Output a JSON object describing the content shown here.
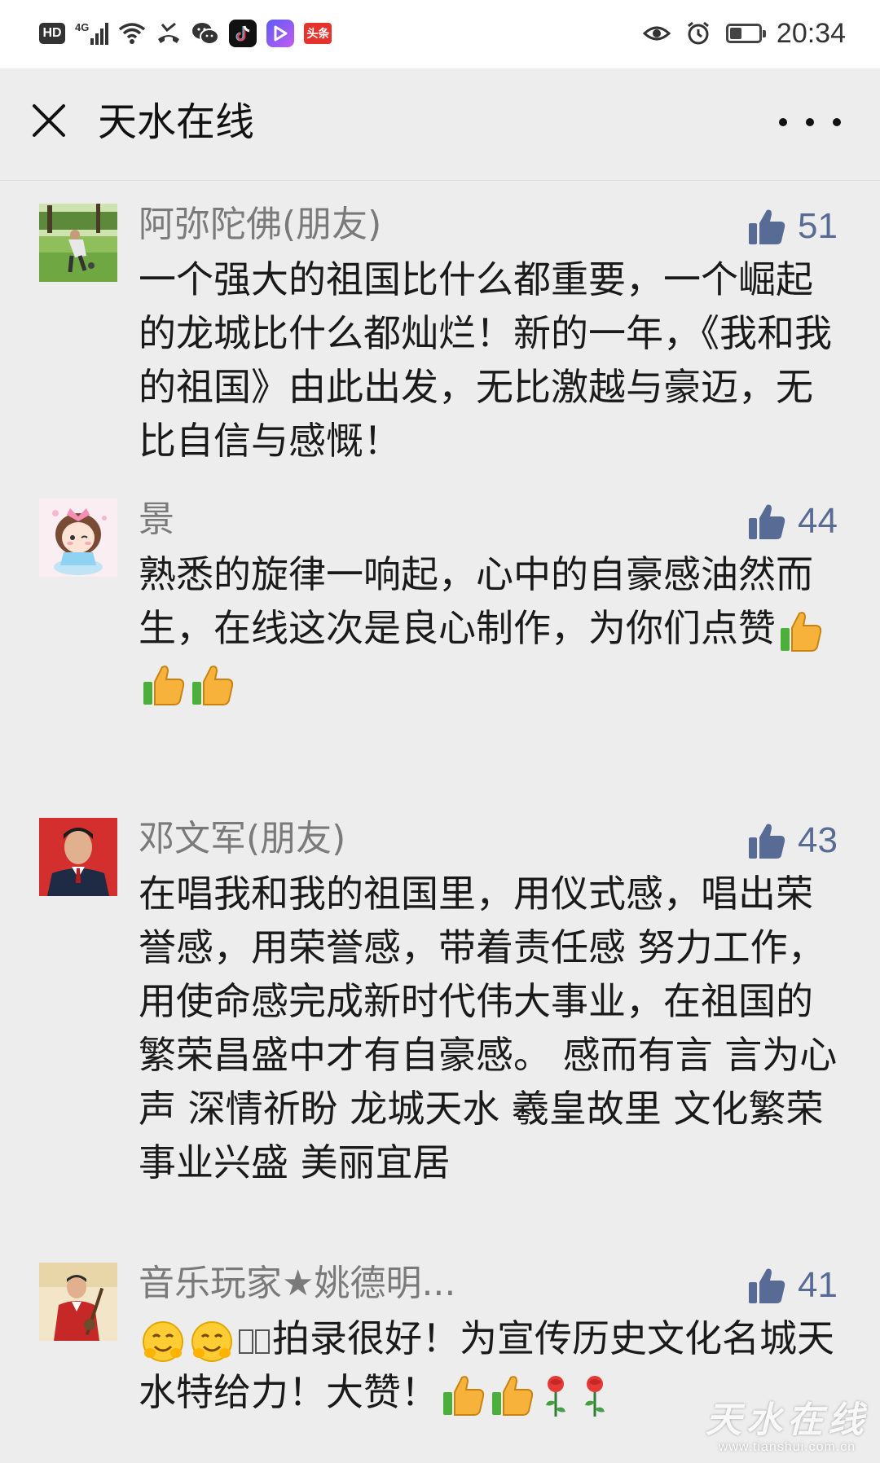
{
  "status_bar": {
    "hd_label": "HD",
    "network_label": "4G",
    "toutiao_label": "头条",
    "battery_level": 0.4,
    "time": "20:34",
    "icons": [
      "hd-icon",
      "signal-icon",
      "wifi-icon",
      "missed-call-icon",
      "wechat-icon",
      "tiktok-icon",
      "video-app-icon",
      "toutiao-icon",
      "eye-icon",
      "alarm-icon",
      "battery-icon"
    ]
  },
  "nav": {
    "title": "天水在线",
    "close_icon": "close-icon",
    "more_icon": "more-icon"
  },
  "colors": {
    "background": "#ededed",
    "like_blue": "#576b95",
    "nickname_gray": "#7a7a7a"
  },
  "comments": [
    {
      "nickname": "阿弥陀佛(朋友)",
      "likes": "51",
      "text": "一个强大的祖国比什么都重要，一个崛起的龙城比什么都灿烂！新的一年，《我和我的祖国》由此出发，无比激越与豪迈，无比自信与感慨！"
    },
    {
      "nickname": "景",
      "likes": "44",
      "text": "熟悉的旋律一响起，心中的自豪感油然而生，在线这次是良心制作，为你们点赞"
    },
    {
      "nickname": "邓文军(朋友)",
      "likes": "43",
      "text": "在唱我和我的祖国里，用仪式感，唱出荣誉感，用荣誉感，带着责任感 努力工作，用使命感完成新时代伟大事业，在祖国的繁荣昌盛中才有自豪感。 感而有言 言为心声 深情祈盼 龙城天水 羲皇故里  文化繁荣 事业兴盛  美丽宜居"
    },
    {
      "nickname": "音乐玩家★姚德明...",
      "likes": "41",
      "text_main": "拍录很好！为宣传历史文化名城天水特给力！大赞！"
    }
  ],
  "watermark": {
    "logo": "天水在线",
    "url": "www.tianshui.com.cn"
  }
}
